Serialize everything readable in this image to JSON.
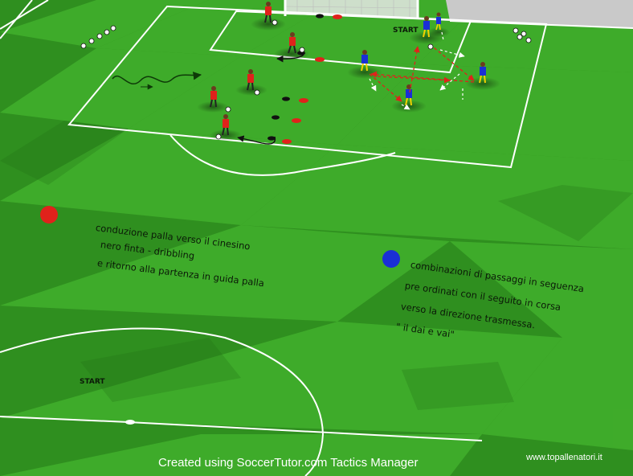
{
  "labels": {
    "start_top": "START",
    "start_bottom": "START",
    "footer": "Created using SoccerTutor.com Tactics Manager",
    "site": "www.topallenatori.it"
  },
  "notes": {
    "red_line1": "conduzione palla verso il cinesino",
    "red_line2": "nero  finta - dribbling",
    "red_line3": "e ritorno alla partenza in guida palla",
    "blue_line1": "combinazioni di passaggi in seguenza",
    "blue_line2": "pre ordinati  con il seguito in corsa",
    "blue_line3": "verso la direzione trasmessa.",
    "blue_line4": "\" il dai e  vai\""
  },
  "colors": {
    "grass_light": "#43b32a",
    "grass_dark": "#2f8f1f",
    "lines": "#ffffff",
    "red_team": "#e0221b",
    "blue_team": "#1a2fd6",
    "cone_red": "#e0221b",
    "cone_black": "#111111"
  },
  "icons": [
    "soccer-ball-icon",
    "cone-icon",
    "player-icon",
    "goal-icon",
    "team-marker-icon"
  ]
}
